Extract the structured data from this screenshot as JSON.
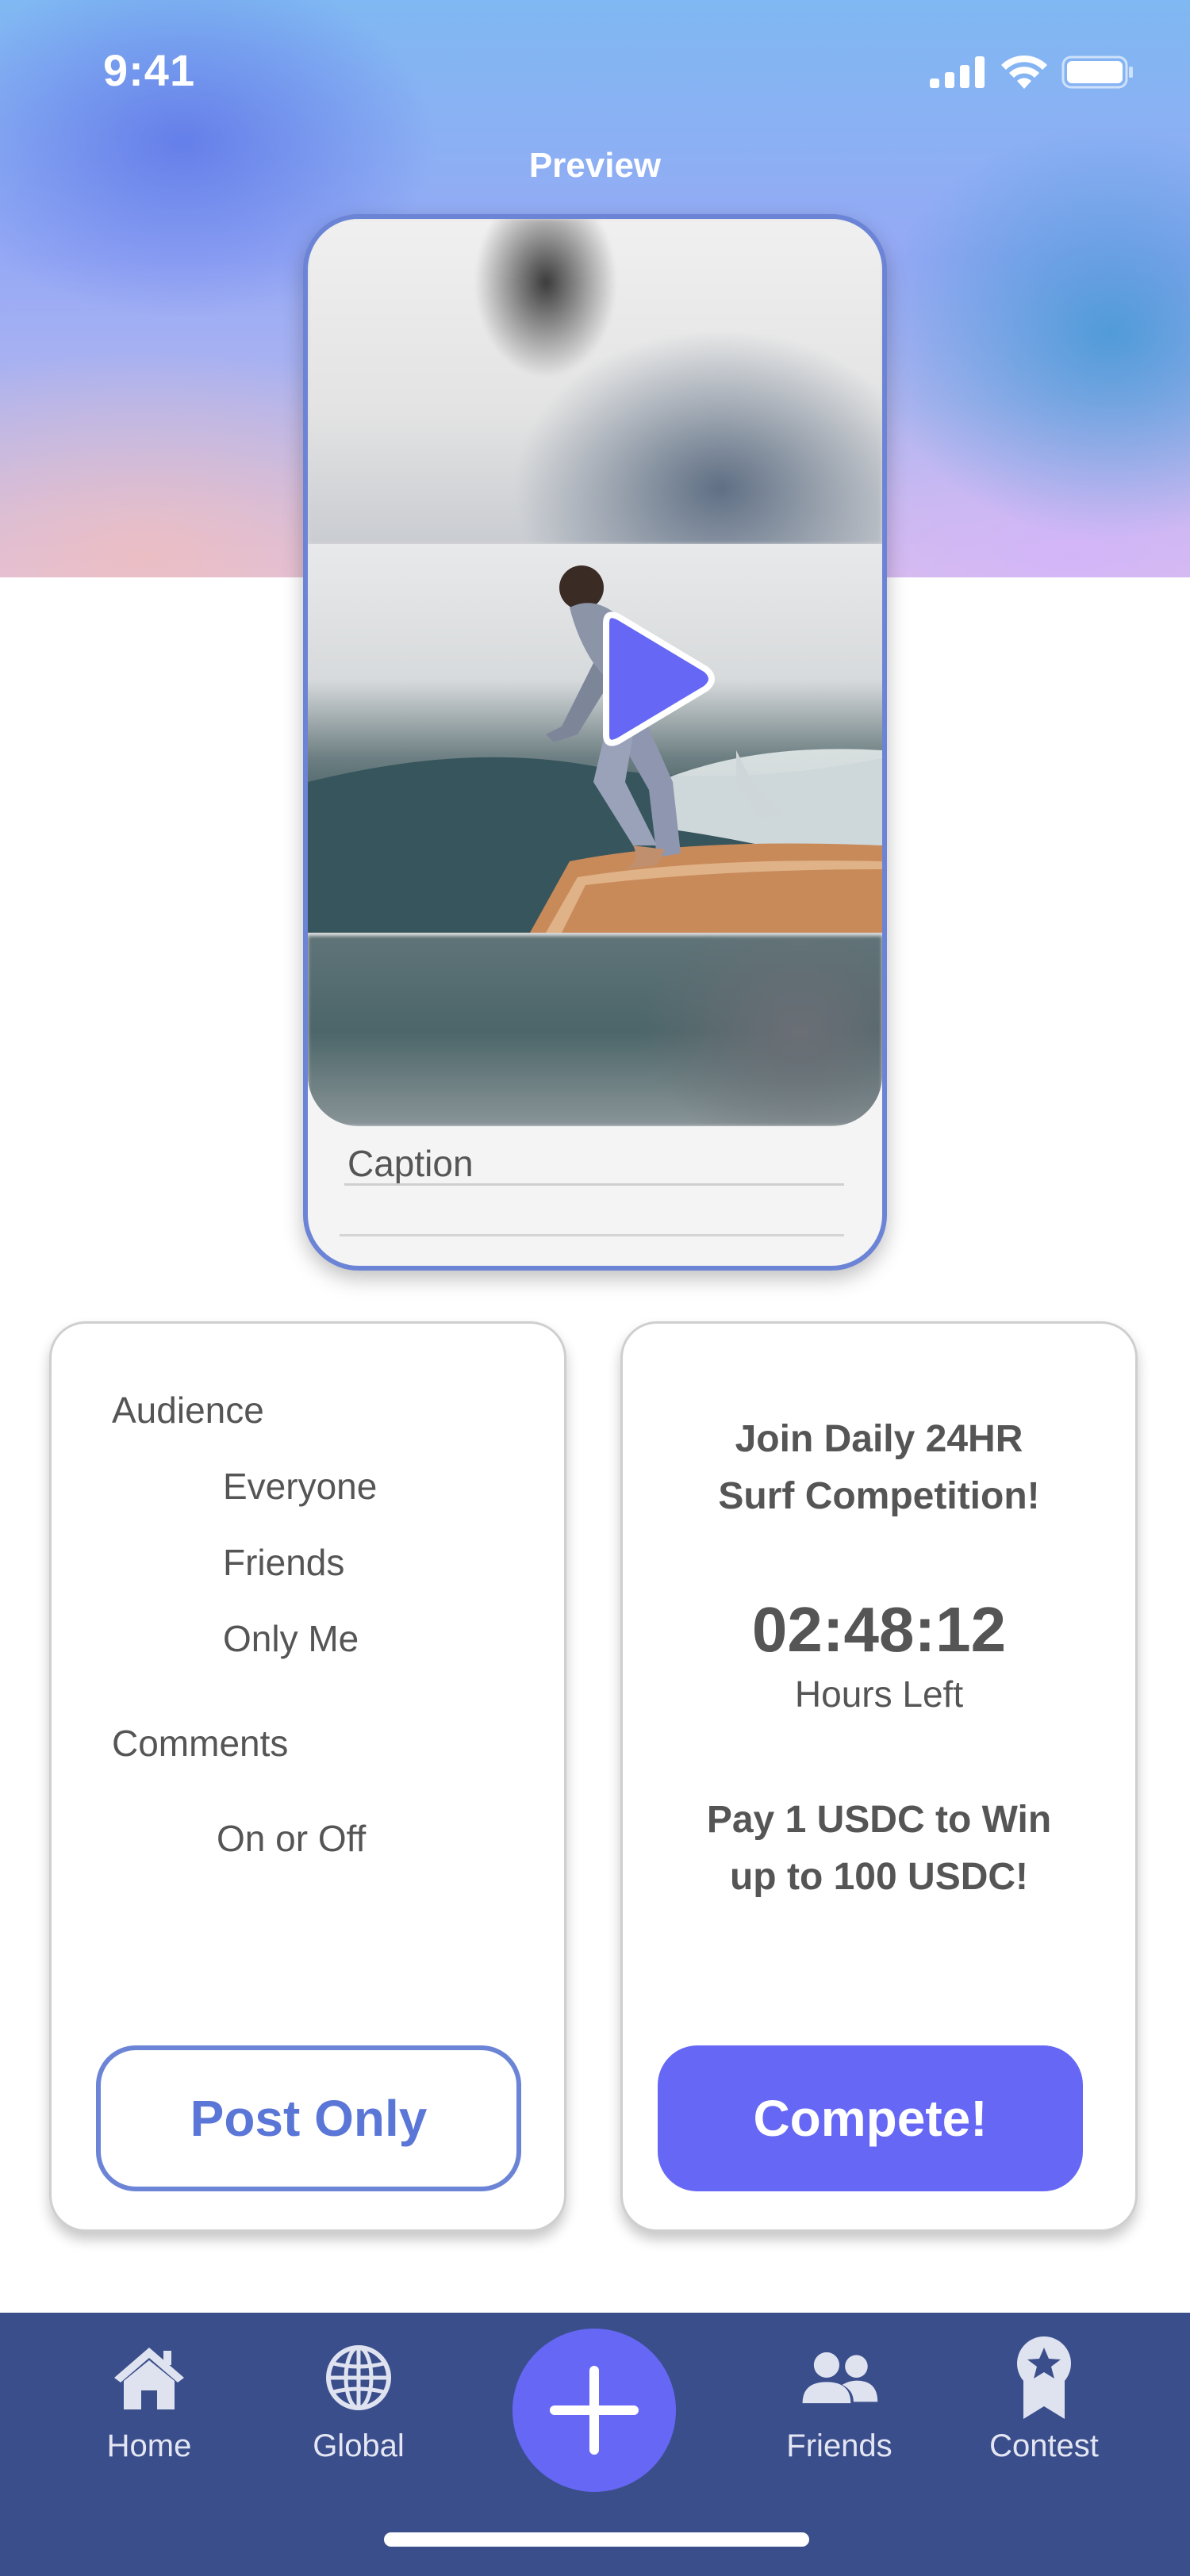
{
  "status_bar": {
    "time": "9:41",
    "icons": [
      "signal-icon",
      "wifi-icon",
      "battery-icon"
    ]
  },
  "preview": {
    "title": "Preview",
    "caption_placeholder": "Caption",
    "play_icon": "play-icon"
  },
  "settings_card": {
    "audience_label": "Audience",
    "audience_options": [
      "Everyone",
      "Friends",
      "Only Me"
    ],
    "comments_label": "Comments",
    "comments_option": "On or Off",
    "post_button": "Post Only"
  },
  "competition_card": {
    "title_line1": "Join Daily 24HR",
    "title_line2": "Surf Competition!",
    "timer": "02:48:12",
    "timer_label": "Hours Left",
    "prize_line1": "Pay 1 USDC to Win",
    "prize_line2": "up to 100 USDC!",
    "compete_button": "Compete!"
  },
  "tab_bar": {
    "items": [
      {
        "label": "Home",
        "icon": "home-icon"
      },
      {
        "label": "Global",
        "icon": "globe-icon"
      },
      {
        "label": "Friends",
        "icon": "friends-icon"
      },
      {
        "label": "Contest",
        "icon": "award-icon"
      }
    ],
    "center_action_icon": "plus-icon"
  },
  "colors": {
    "accent": "#6668f5",
    "outline": "#6b84d6",
    "tabbar": "#3b4e8c",
    "text": "#555555"
  }
}
